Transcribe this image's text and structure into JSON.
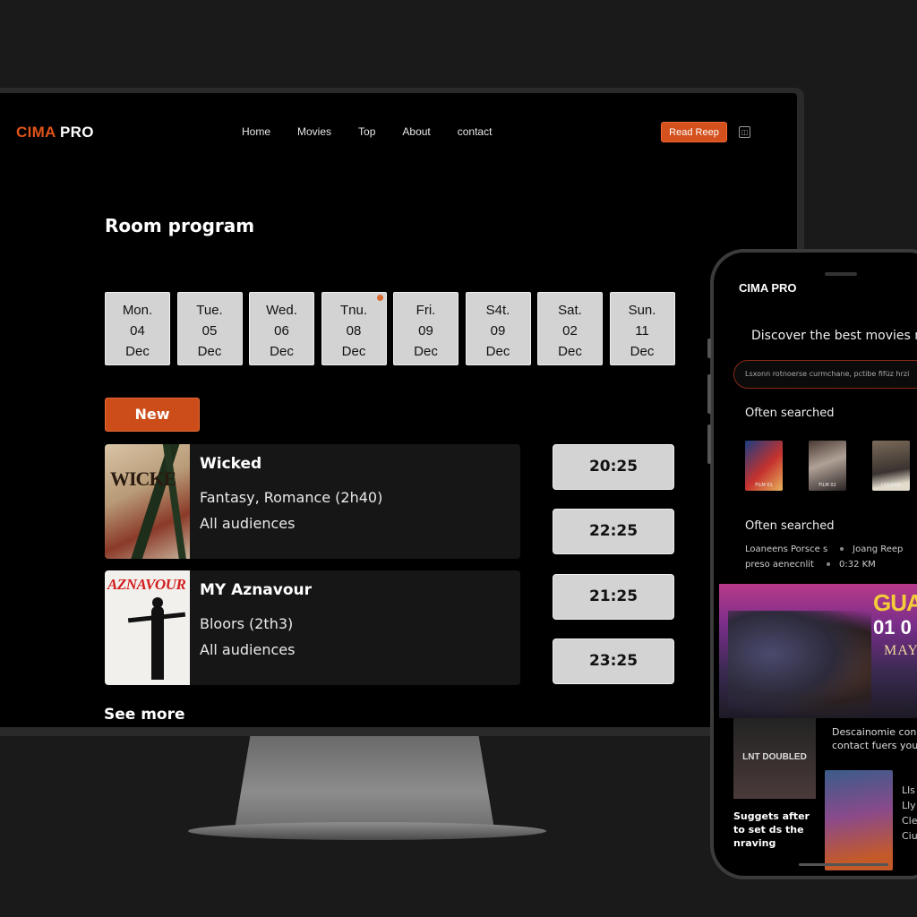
{
  "desktop": {
    "logo": {
      "accent": "CIMA",
      "rest": " PRO"
    },
    "nav": {
      "links": [
        "Home",
        "Movies",
        "Top",
        "About",
        "contact"
      ],
      "cta_label": "Read Reep",
      "icon": "square-icon"
    },
    "page_title": "Room program",
    "days": [
      {
        "day": "Mon.",
        "num": "04",
        "month": "Dec"
      },
      {
        "day": "Tue.",
        "num": "05",
        "month": "Dec"
      },
      {
        "day": "Wed.",
        "num": "06",
        "month": "Dec"
      },
      {
        "day": "Tnu.",
        "num": "08",
        "month": "Dec"
      },
      {
        "day": "Fri.",
        "num": "09",
        "month": "Dec"
      },
      {
        "day": "S4t.",
        "num": "09",
        "month": "Dec"
      },
      {
        "day": "Sat.",
        "num": "02",
        "month": "Dec"
      },
      {
        "day": "Sun.",
        "num": "11",
        "month": "Dec"
      }
    ],
    "new_label": "New",
    "movies": [
      {
        "poster_text": "WICKE",
        "title": "Wicked",
        "genre": "Fantasy, Romance (2h40)",
        "audience": "All audiences",
        "times": [
          "20:25",
          "22:25"
        ]
      },
      {
        "poster_text": "AZNAVOUR",
        "title": "MY Aznavour",
        "genre": "Bloors (2th3)",
        "audience": "All audiences",
        "times": [
          "21:25",
          "23:25"
        ]
      }
    ],
    "see_more": "See more"
  },
  "mobile": {
    "logo": "CIMA PRO",
    "heading": "Discover the best movies n",
    "search_placeholder": "Lsxonn rotnoerse curmchane, pctibe fifüz hrzi",
    "often_searched_1": "Often searched",
    "thumbnails": [
      {
        "label": "FILM 01"
      },
      {
        "label": "FILM 02"
      },
      {
        "label": "LOILOOK"
      }
    ],
    "often_searched_2": "Often searched",
    "list": [
      {
        "left": "Loaneens Porsce s",
        "right": "Joang Reep"
      },
      {
        "left": "preso aenecnlit",
        "right": "0:32 KM"
      }
    ],
    "banner": {
      "title": "GUA",
      "date": "01 0",
      "month": "MAY"
    },
    "small_poster_text": "LNT DOUBLED",
    "side_text": "Descainomie con contact fuers you",
    "suggest": "Suggets after to set ds the nraving",
    "side_text2": [
      "Lls",
      "Lly",
      "Cle",
      "Ciu"
    ]
  },
  "colors": {
    "accent": "#d4501c",
    "background": "#000000",
    "tile": "#d3d3d3"
  }
}
